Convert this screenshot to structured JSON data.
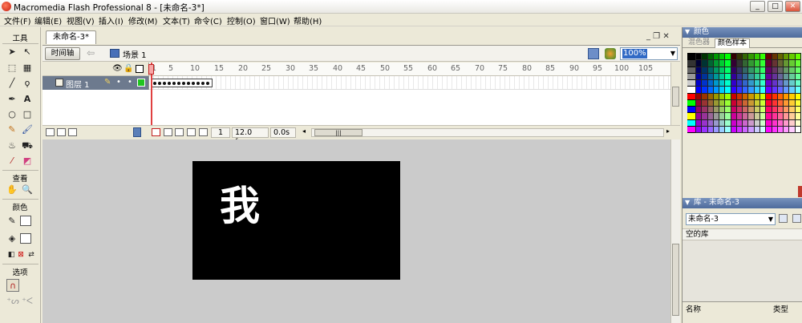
{
  "window": {
    "title": "Macromedia Flash Professional 8 - [未命名-3*]",
    "controls": [
      "_",
      "□",
      "✕"
    ]
  },
  "menu": [
    "文件(F)",
    "编辑(E)",
    "视图(V)",
    "插入(I)",
    "修改(M)",
    "文本(T)",
    "命令(C)",
    "控制(O)",
    "窗口(W)",
    "帮助(H)"
  ],
  "tools": {
    "label_tools": "工具",
    "label_view": "查看",
    "label_colors": "颜色",
    "label_options": "选项"
  },
  "document": {
    "tab": "未命名-3*",
    "timeline_button": "时间轴",
    "scene": "场景 1",
    "zoom": "100%",
    "doc_buttons": "_ ❐ ✕"
  },
  "timeline": {
    "layer_name": "图层 1",
    "ruler_ticks": [
      "1",
      "5",
      "10",
      "15",
      "20",
      "25",
      "30",
      "35",
      "40",
      "45",
      "50",
      "55",
      "60",
      "65",
      "70",
      "75",
      "80",
      "85",
      "90",
      "95",
      "100",
      "105"
    ],
    "current_frame": "1",
    "fps": "12.0 fps",
    "time": "0.0s"
  },
  "stage": {
    "text": "我",
    "background": "#000000",
    "text_color": "#ffffff"
  },
  "panels": {
    "color": {
      "title": "颜色",
      "tab_mixer": "混色器",
      "tab_swatches": "颜色样本"
    },
    "library": {
      "title": "库 - 未命名-3",
      "selected": "未命名-3",
      "status": "空的库",
      "col_name": "名称",
      "col_type": "类型"
    }
  }
}
